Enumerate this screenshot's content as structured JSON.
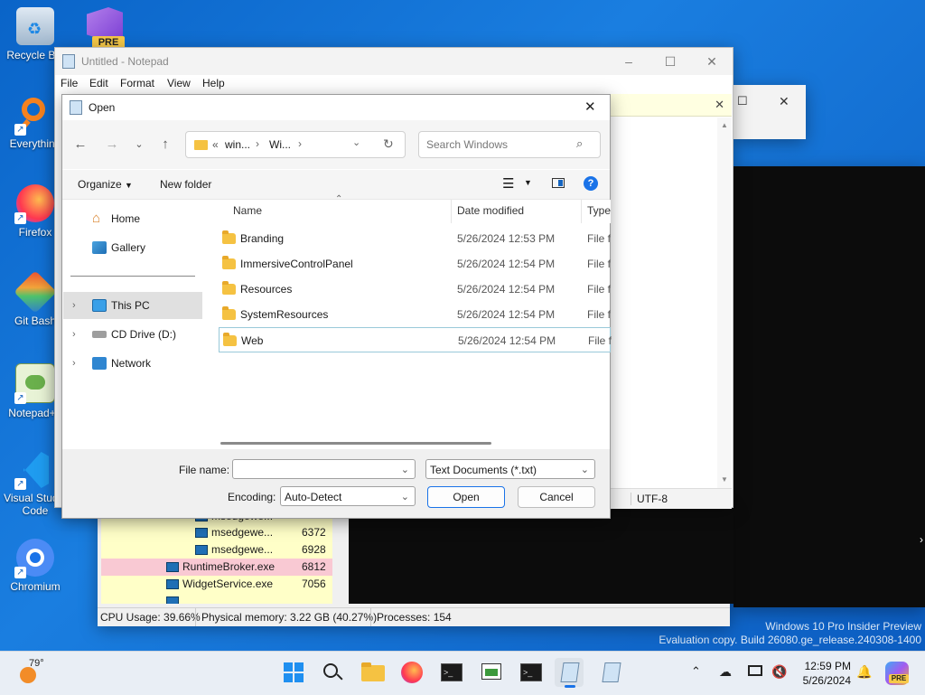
{
  "desktop": {
    "icons": [
      {
        "label": "Recycle Bin"
      },
      {
        "label": "Everything"
      },
      {
        "label": "Firefox"
      },
      {
        "label": "Git Bash"
      },
      {
        "label": "Notepad++"
      },
      {
        "label": "Visual Studio Code"
      },
      {
        "label": "Chromium"
      }
    ],
    "pre_badge": "PRE",
    "watermark_line1": "Windows 10 Pro Insider Preview",
    "watermark_line2": "Evaluation copy. Build 26080.ge_release.240308-1400"
  },
  "notepad": {
    "title": "Untitled - Notepad",
    "menu": [
      "File",
      "Edit",
      "Format",
      "View",
      "Help"
    ],
    "status_encoding": "UTF-8"
  },
  "taskmgr": {
    "rows": [
      {
        "name": "msedgewe...",
        "value": ""
      },
      {
        "name": "msedgewe...",
        "value": "6372"
      },
      {
        "name": "msedgewe...",
        "value": "6928"
      },
      {
        "name": "RuntimeBroker.exe",
        "value": "6812"
      },
      {
        "name": "WidgetService.exe",
        "value": "7056"
      },
      {
        "name": "",
        "value": ""
      }
    ],
    "status": {
      "cpu": "CPU Usage: 39.66%",
      "memory": "Physical memory: 3.22 GB (40.27%)",
      "processes": "Processes: 154"
    },
    "colors": {
      "yellow": "#ffffc8",
      "pink": "#f9c9d3"
    }
  },
  "dialog": {
    "title": "Open",
    "breadcrumb": {
      "prefix": "«",
      "parts": [
        "win...",
        "Wi..."
      ]
    },
    "search_placeholder": "Search Windows",
    "toolbar": {
      "organize": "Organize",
      "new_folder": "New folder"
    },
    "nav": [
      {
        "label": "Home",
        "expandable": false
      },
      {
        "label": "Gallery",
        "expandable": false
      },
      {
        "label": "This PC",
        "expandable": true,
        "selected": true
      },
      {
        "label": "CD Drive (D:)",
        "expandable": true
      },
      {
        "label": "Network",
        "expandable": true
      }
    ],
    "columns": {
      "name": "Name",
      "date": "Date modified",
      "type": "Type"
    },
    "files": [
      {
        "name": "Branding",
        "date": "5/26/2024 12:53 PM",
        "type": "File folder"
      },
      {
        "name": "ImmersiveControlPanel",
        "date": "5/26/2024 12:54 PM",
        "type": "File folder"
      },
      {
        "name": "Resources",
        "date": "5/26/2024 12:54 PM",
        "type": "File folder"
      },
      {
        "name": "SystemResources",
        "date": "5/26/2024 12:54 PM",
        "type": "File folder"
      },
      {
        "name": "Web",
        "date": "5/26/2024 12:54 PM",
        "type": "File folder"
      }
    ],
    "file_name_label": "File name:",
    "file_name_value": "",
    "file_type": "Text Documents (*.txt)",
    "encoding_label": "Encoding:",
    "encoding_value": "Auto-Detect",
    "open_button": "Open",
    "cancel_button": "Cancel"
  },
  "taskbar": {
    "weather_temp": "79°",
    "time": "12:59 PM",
    "date": "5/26/2024",
    "pre_badge": "PRE"
  }
}
